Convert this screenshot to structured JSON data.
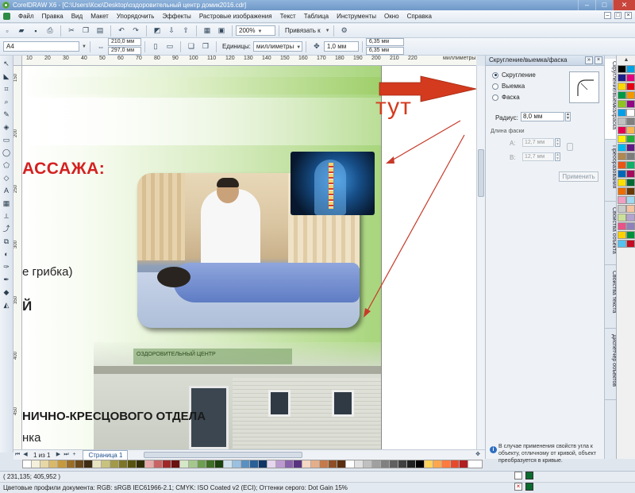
{
  "titlebar": {
    "title": "CorelDRAW X6 - [C:\\Users\\Ксю\\Desktop\\оздоровительный центр домик2016.cdr]"
  },
  "menu": [
    "Файл",
    "Правка",
    "Вид",
    "Макет",
    "Упорядочить",
    "Эффекты",
    "Растровые изображения",
    "Текст",
    "Таблица",
    "Инструменты",
    "Окно",
    "Справка"
  ],
  "toolbar1": {
    "zoom": "200%",
    "snap": "Привязать к"
  },
  "toolbar2": {
    "page_size": "A4",
    "width": "210,0 мм",
    "height": "297,0 мм",
    "units_label": "Единицы:",
    "units": "миллиметры",
    "nudge": "1,0 мм",
    "dup_x": "6,35 мм",
    "dup_y": "6,35 мм"
  },
  "ruler": {
    "top_ticks": [
      "10",
      "20",
      "30",
      "40",
      "50",
      "60",
      "70",
      "80",
      "90",
      "100",
      "110",
      "120",
      "130",
      "140",
      "150",
      "160",
      "170",
      "180",
      "190",
      "200",
      "210",
      "220"
    ],
    "top_unit": "миллиметры",
    "left_ticks": [
      "150",
      "200",
      "250",
      "300",
      "350",
      "400",
      "450"
    ]
  },
  "artwork": {
    "heading": "АССАЖА:",
    "line1": "е грибка)",
    "line2": "Й",
    "line3": "НИЧНО-КРЕСЦОВОГО ОТДЕЛА",
    "line4": "нка",
    "annotation": "тут",
    "building_sign": "ОЗДОРОВИТЕЛЬНЫЙ ЦЕНТР"
  },
  "docker": {
    "title": "Скругление/выемка/фаска",
    "options": [
      "Скругление",
      "Выемка",
      "Фаска"
    ],
    "selected": "Скругление",
    "radius_label": "Радиус:",
    "radius_value": "8,0 мм",
    "chamfer_label": "Длина фаски",
    "a_label": "A:",
    "a_value": "12,7 мм",
    "b_label": "B:",
    "b_value": "12,7 мм",
    "apply": "Применить",
    "info": "В случае применения свойств угла к объекту, отличному от кривой, объект преобразуется в кривые."
  },
  "docker_tabs": [
    "Скругление/выемка/фаска",
    "Преобразования",
    "Свойства объекта",
    "Свойства текста",
    "Диспетчер объектов"
  ],
  "pager": {
    "count": "1 из 1",
    "tab": "Страница 1"
  },
  "status": {
    "coords": "( 231,135; 405,952 )",
    "profiles": "Цветовые профили документа: RGB: sRGB IEC61966-2.1; CMYK: ISO Coated v2 (ECI); Оттенки серого: Dot Gain 15%"
  },
  "colors": {
    "accent_red": "#d42020",
    "arrow_red": "#d33a1e",
    "palette": [
      "#000000",
      "#00a0e3",
      "#1d2088",
      "#e4007f",
      "#ffd700",
      "#e60012",
      "#009944",
      "#f39800",
      "#8fc31f",
      "#920783",
      "#00a0e9",
      "#ffffff",
      "#c0c0c0",
      "#808080",
      "#e5004f",
      "#f8b551",
      "#fff100",
      "#22ac38",
      "#00b7ee",
      "#601986",
      "#b28850",
      "#7d7d7d",
      "#ea5514",
      "#13ae67",
      "#0068b7",
      "#a40b5d",
      "#ffe100",
      "#006934",
      "#ed6d00",
      "#6a3906",
      "#f19ec2",
      "#a0d8ef",
      "#c9caca",
      "#f6c4a0",
      "#cce198",
      "#b4a3d0",
      "#e95388",
      "#8f82bc",
      "#fdd000",
      "#00913a",
      "#54c3f1",
      "#c30d23"
    ],
    "strip": [
      "#ffffff",
      "#f4f0dc",
      "#e7d7a6",
      "#d9b86a",
      "#c6993f",
      "#9b6e27",
      "#6a4a1d",
      "#3e2d13",
      "#e9e4c0",
      "#c8c27e",
      "#a29a48",
      "#7d7628",
      "#58540f",
      "#2f2e05",
      "#e8a8a8",
      "#c86464",
      "#a02828",
      "#6a1010",
      "#d6e6c8",
      "#a4c88c",
      "#6e9e52",
      "#3f6e26",
      "#1c4010",
      "#cfe1ef",
      "#9cc0df",
      "#5a90c1",
      "#2a5f97",
      "#0f3566",
      "#e6d6ee",
      "#bb9bcf",
      "#8a62ac",
      "#59337f",
      "#f6d7c3",
      "#e6ae88",
      "#c47a4a",
      "#8f4f26",
      "#5a2e0f",
      "#ffffff",
      "#e0e0e0",
      "#c0c0c0",
      "#a0a0a0",
      "#808080",
      "#606060",
      "#404040",
      "#202020",
      "#000000",
      "#ffd25a",
      "#ffa64d",
      "#ff7a3d",
      "#e64a2e",
      "#b02020"
    ]
  }
}
